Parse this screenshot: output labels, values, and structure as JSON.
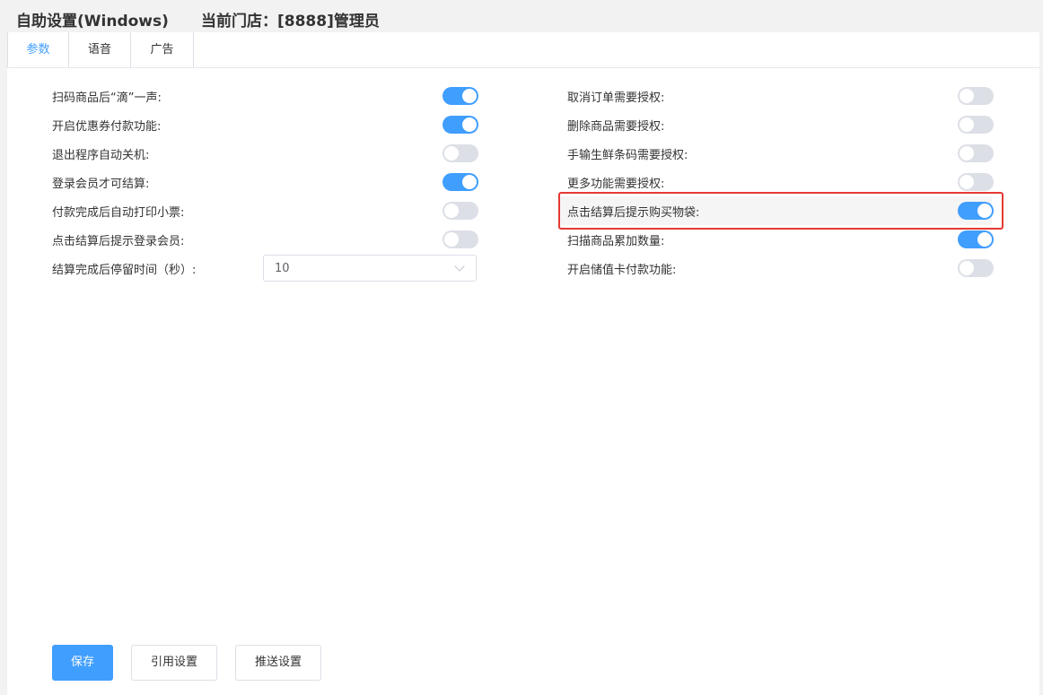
{
  "header": {
    "title": "自助设置(Windows)",
    "store": "当前门店：[8888]管理员"
  },
  "tabs": [
    {
      "label": "参数",
      "active": true
    },
    {
      "label": "语音",
      "active": false
    },
    {
      "label": "广告",
      "active": false
    }
  ],
  "left_settings": [
    {
      "label": "扫码商品后“滴”一声:",
      "on": true
    },
    {
      "label": "开启优惠券付款功能:",
      "on": true
    },
    {
      "label": "退出程序自动关机:",
      "on": false
    },
    {
      "label": "登录会员才可结算:",
      "on": true
    },
    {
      "label": "付款完成后自动打印小票:",
      "on": false
    },
    {
      "label": "点击结算后提示登录会员:",
      "on": false
    }
  ],
  "stay_time": {
    "label": "结算完成后停留时间（秒）:",
    "value": "10"
  },
  "right_settings": [
    {
      "label": "取消订单需要授权:",
      "on": false
    },
    {
      "label": "删除商品需要授权:",
      "on": false
    },
    {
      "label": "手输生鲜条码需要授权:",
      "on": false
    },
    {
      "label": "更多功能需要授权:",
      "on": false
    },
    {
      "label": "点击结算后提示购买物袋:",
      "on": true
    },
    {
      "label": "扫描商品累加数量:",
      "on": true
    },
    {
      "label": "开启储值卡付款功能:",
      "on": false
    }
  ],
  "buttons": {
    "save": "保存",
    "reference": "引用设置",
    "push": "推送设置"
  },
  "colors": {
    "accent": "#409eff",
    "switch_off": "#dcdfe6",
    "highlight": "#e53935"
  }
}
